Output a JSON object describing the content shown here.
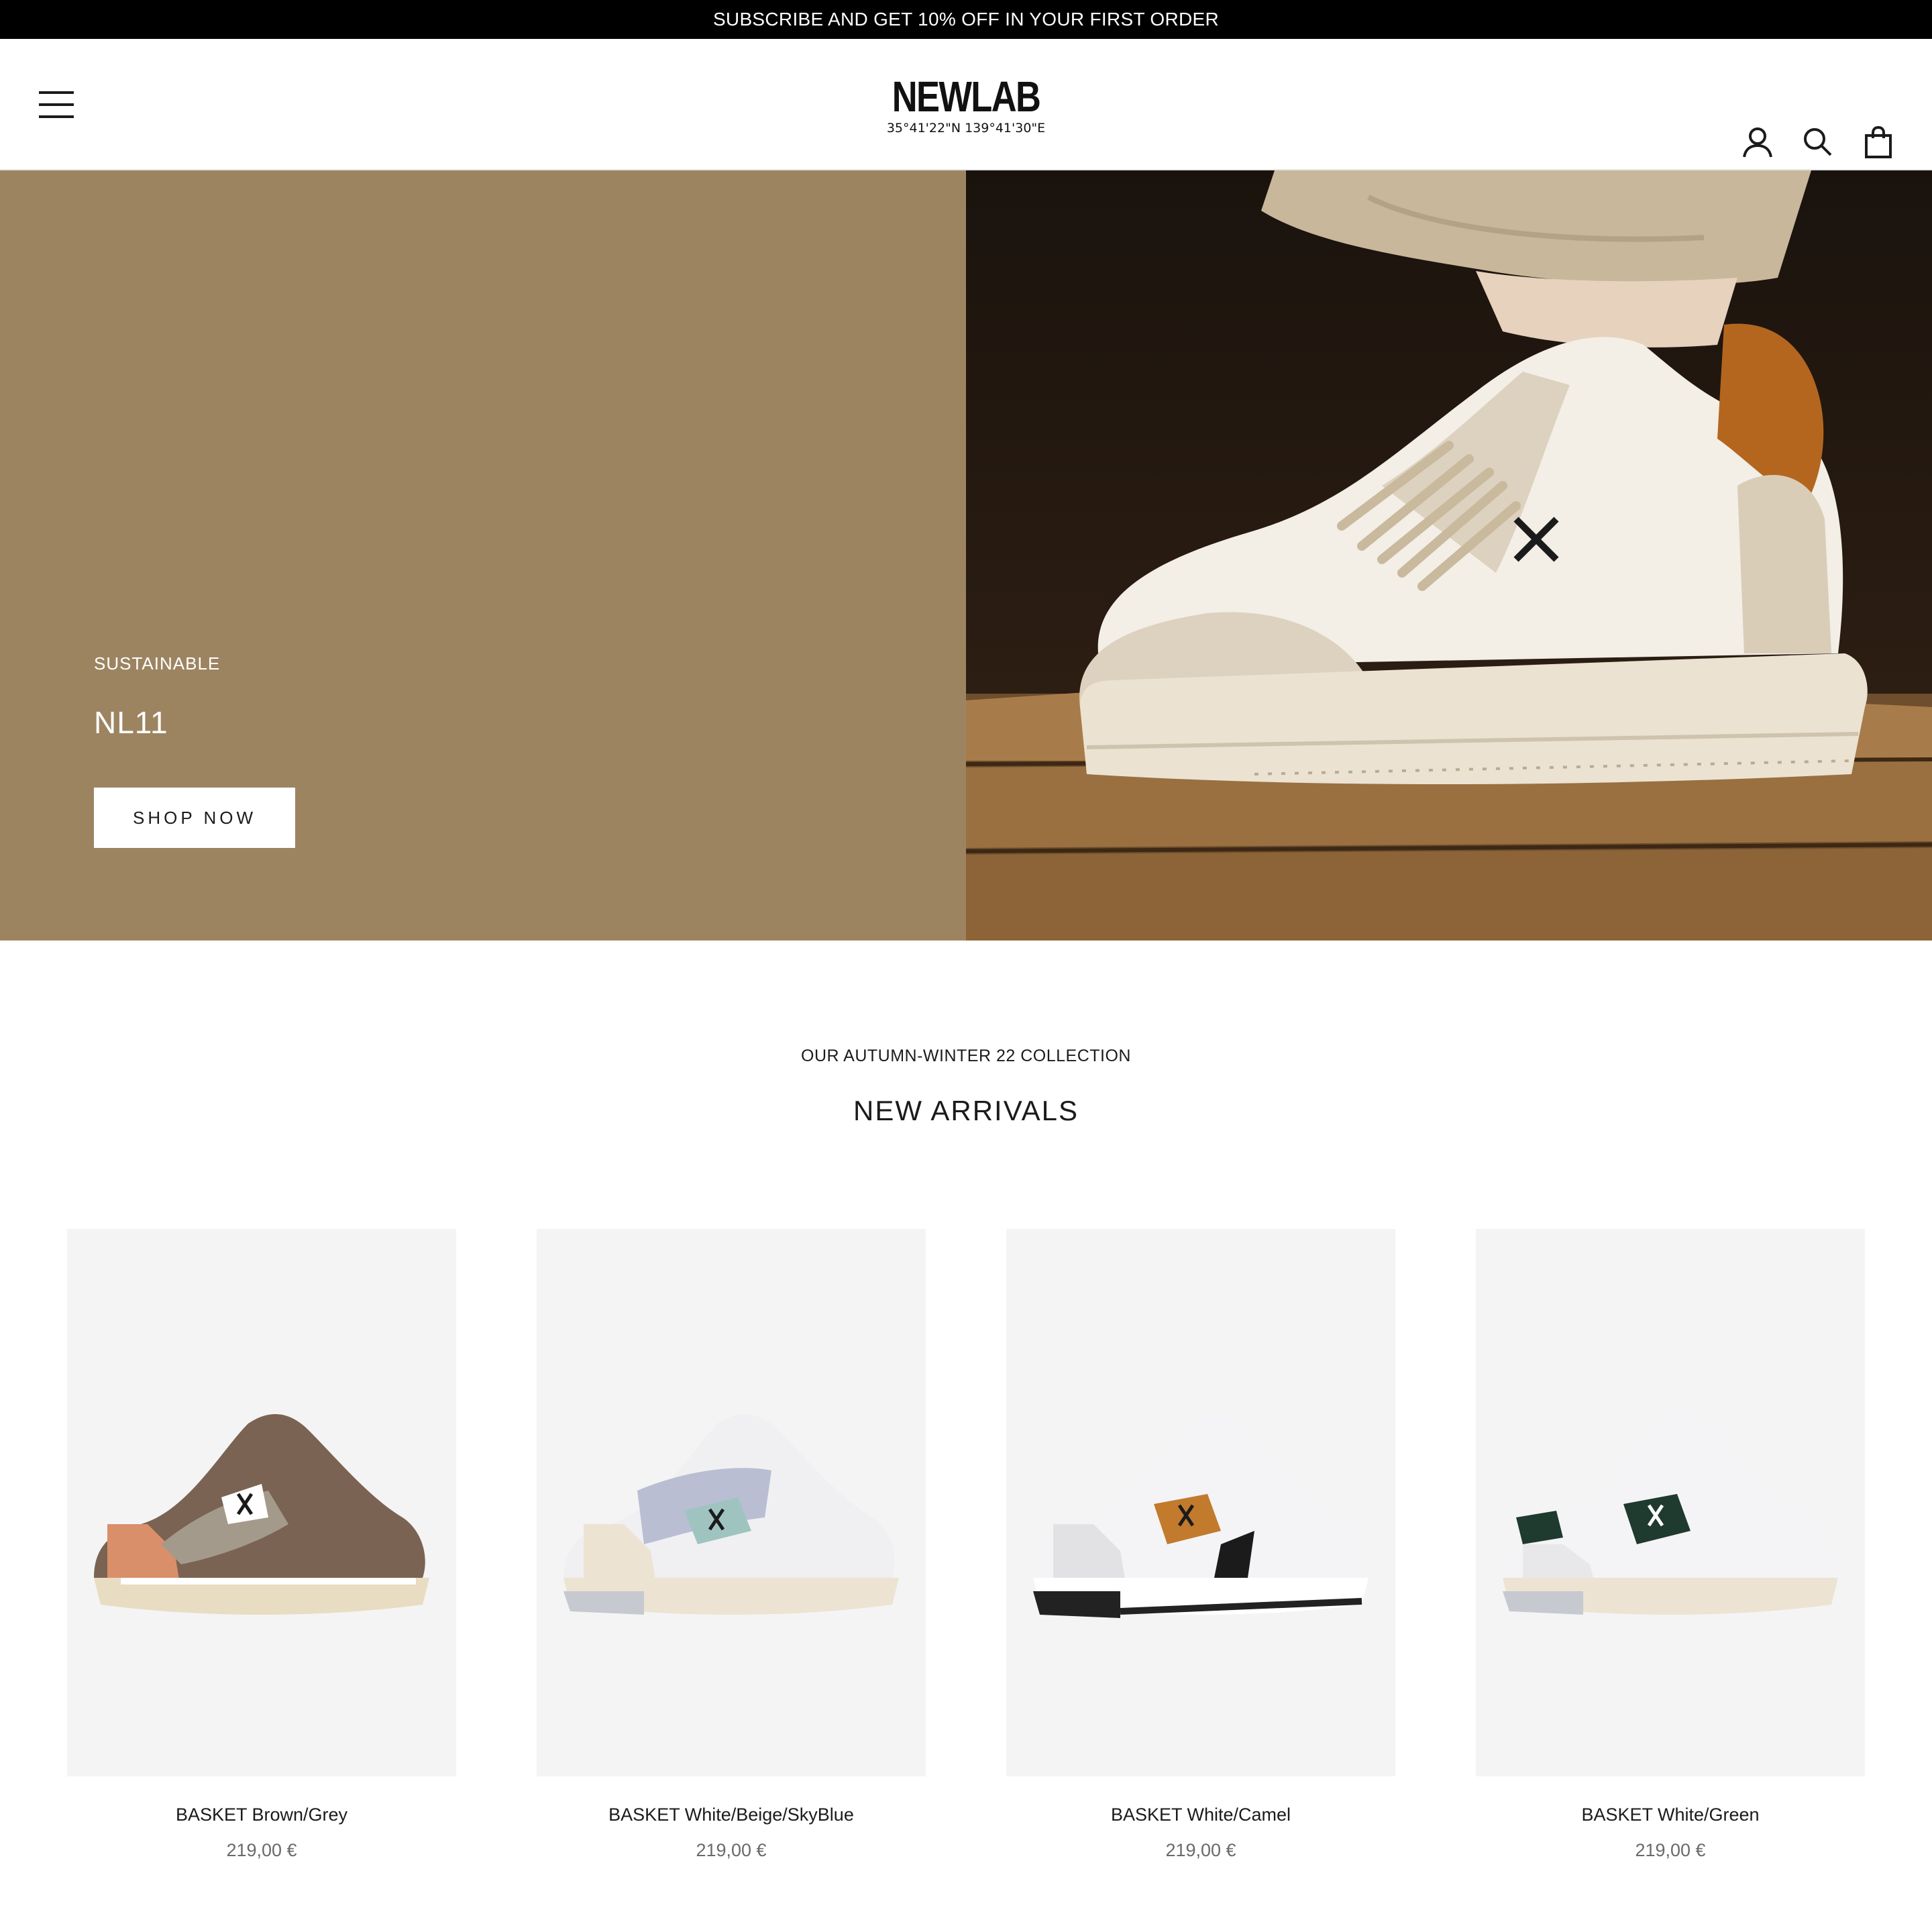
{
  "announcement": {
    "text": "SUBSCRIBE AND GET 10% OFF IN YOUR FIRST ORDER"
  },
  "header": {
    "logo_text": "NEWLAB",
    "logo_coords": "35°41'22\"N 139°41'30\"E"
  },
  "hero": {
    "subtitle": "SUSTAINABLE",
    "title": "NL11",
    "cta_label": "SHOP NOW",
    "panel_color": "#9d8461"
  },
  "collection": {
    "subtitle": "OUR AUTUMN-WINTER 22 COLLECTION",
    "title": "NEW ARRIVALS"
  },
  "products": [
    {
      "name": "BASKET Brown/Grey",
      "price": "219,00 €",
      "accent": "#7a6352"
    },
    {
      "name": "BASKET White/Beige/SkyBlue",
      "price": "219,00 €",
      "accent": "#9fc4c0"
    },
    {
      "name": "BASKET White/Camel",
      "price": "219,00 €",
      "accent": "#c27a2c"
    },
    {
      "name": "BASKET White/Green",
      "price": "219,00 €",
      "accent": "#1f3a2e"
    }
  ]
}
